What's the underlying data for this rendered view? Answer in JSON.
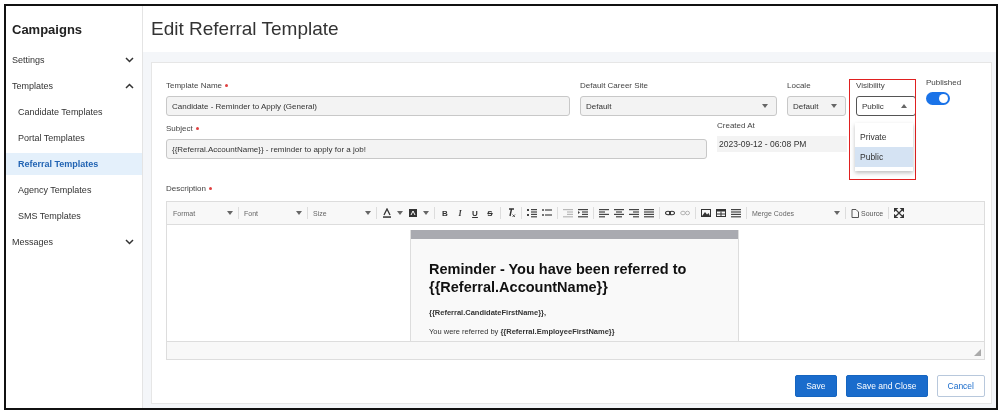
{
  "sidebar": {
    "title": "Campaigns",
    "items": [
      {
        "label": "Settings",
        "kind": "group",
        "expanded": false,
        "selected": false
      },
      {
        "label": "Templates",
        "kind": "group",
        "expanded": true,
        "selected": false
      },
      {
        "label": "Candidate Templates",
        "kind": "link",
        "selected": false
      },
      {
        "label": "Portal Templates",
        "kind": "link",
        "selected": false
      },
      {
        "label": "Referral Templates",
        "kind": "link",
        "selected": true
      },
      {
        "label": "Agency Templates",
        "kind": "link",
        "selected": false
      },
      {
        "label": "SMS Templates",
        "kind": "link",
        "selected": false
      },
      {
        "label": "Messages",
        "kind": "group",
        "expanded": false,
        "selected": false
      }
    ]
  },
  "page_title": "Edit Referral Template",
  "form": {
    "template_name": {
      "label": "Template Name",
      "required": true,
      "value": "Candidate - Reminder to Apply (General)"
    },
    "career_site": {
      "label": "Default Career Site",
      "value": "Default"
    },
    "locale": {
      "label": "Locale",
      "value": "Default"
    },
    "visibility": {
      "label": "Visibility",
      "value": "Public",
      "expanded": true,
      "options": [
        {
          "label": "Private",
          "selected": false
        },
        {
          "label": "Public",
          "selected": true
        }
      ]
    },
    "published": {
      "label": "Published",
      "on": true
    },
    "subject": {
      "label": "Subject",
      "required": true,
      "value": "{{Referral.AccountName}} - reminder to apply for a job!"
    },
    "created_at": {
      "label": "Created At",
      "value": "2023-09-12 - 06:08 PM"
    },
    "description": {
      "label": "Description",
      "required": true
    }
  },
  "toolbar": {
    "format": "Format",
    "font": "Font",
    "size": "Size",
    "bold": "B",
    "italic": "I",
    "underline": "U",
    "strike": "S",
    "merge_codes": "Merge Codes",
    "source": "Source"
  },
  "email": {
    "heading": "Reminder - You have been referred to {{Referral.AccountName}}",
    "greeting": "{{Referral.CandidateFirstName}},",
    "body": "You were referred by **{{Referral.EmployeeFirstName}}**"
  },
  "buttons": [
    {
      "label": "Save",
      "kind": "primary"
    },
    {
      "label": "Save and Close",
      "kind": "primary"
    },
    {
      "label": "Cancel",
      "kind": "secondary"
    }
  ]
}
